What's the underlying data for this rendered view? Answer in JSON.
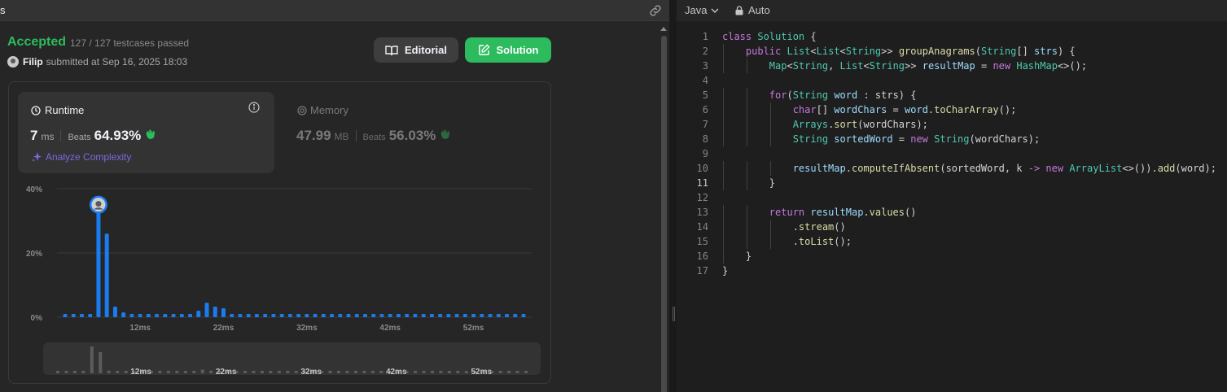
{
  "header": {
    "tab_fragment": "s",
    "link_icon": "link-icon"
  },
  "submission": {
    "status": "Accepted",
    "testcases": "127 / 127 testcases passed",
    "user": "Filip",
    "submitted_at": "submitted at Sep 16, 2025 18:03"
  },
  "buttons": {
    "editorial": "Editorial",
    "solution": "Solution"
  },
  "runtime": {
    "title": "Runtime",
    "value": "7",
    "unit": "ms",
    "beats_label": "Beats",
    "beats_pct": "64.93%",
    "analyze": "Analyze Complexity"
  },
  "memory": {
    "title": "Memory",
    "value": "47.99",
    "unit": "MB",
    "beats_label": "Beats",
    "beats_pct": "56.03%"
  },
  "chart_data": {
    "type": "bar",
    "ylabel_ticks": [
      "40%",
      "20%",
      "0%"
    ],
    "ylim": [
      0,
      40
    ],
    "x_tick_labels": [
      "12ms",
      "22ms",
      "32ms",
      "42ms",
      "52ms"
    ],
    "x_tick_values": [
      12,
      22,
      32,
      42,
      52
    ],
    "x": [
      3,
      4,
      5,
      6,
      7,
      8,
      9,
      10,
      11,
      12,
      13,
      14,
      15,
      16,
      17,
      18,
      19,
      20,
      21,
      22,
      23,
      24,
      25,
      26,
      27,
      28,
      29,
      30,
      31,
      32,
      33,
      34,
      35,
      36,
      37,
      38,
      39,
      40,
      41,
      42,
      43,
      44,
      45,
      46,
      47,
      48,
      49,
      50,
      51,
      52,
      53,
      54,
      55,
      56,
      57,
      58
    ],
    "values": [
      1,
      1,
      1,
      1,
      33,
      26,
      3.3,
      1.5,
      1,
      1,
      1,
      1,
      1,
      1,
      1,
      1,
      2,
      4.5,
      3.3,
      2.8,
      1,
      1,
      1,
      1,
      1,
      1,
      1,
      1,
      1,
      1,
      1,
      1,
      1,
      1,
      1,
      1,
      1,
      1,
      1,
      1,
      1,
      1,
      1,
      1,
      1,
      1,
      1,
      1,
      1,
      1,
      1,
      1,
      1,
      1,
      1,
      1
    ],
    "highlight_x": 7,
    "grid": true
  },
  "editor": {
    "language": "Java",
    "mode": "Auto",
    "active_line": 11,
    "lines": [
      [
        [
          "k",
          "class"
        ],
        [
          "p",
          " "
        ],
        [
          "t",
          "Solution"
        ],
        [
          "p",
          " {"
        ]
      ],
      [
        [
          "p",
          "    "
        ],
        [
          "k",
          "public"
        ],
        [
          "p",
          " "
        ],
        [
          "t",
          "List"
        ],
        [
          "p",
          "<"
        ],
        [
          "t",
          "List"
        ],
        [
          "p",
          "<"
        ],
        [
          "t",
          "String"
        ],
        [
          "p",
          ">> "
        ],
        [
          "f",
          "groupAnagrams"
        ],
        [
          "p",
          "("
        ],
        [
          "t",
          "String"
        ],
        [
          "p",
          "[] "
        ],
        [
          "v",
          "strs"
        ],
        [
          "p",
          ") {"
        ]
      ],
      [
        [
          "p",
          "        "
        ],
        [
          "t",
          "Map"
        ],
        [
          "p",
          "<"
        ],
        [
          "t",
          "String"
        ],
        [
          "p",
          ", "
        ],
        [
          "t",
          "List"
        ],
        [
          "p",
          "<"
        ],
        [
          "t",
          "String"
        ],
        [
          "p",
          ">> "
        ],
        [
          "v",
          "resultMap"
        ],
        [
          "p",
          " = "
        ],
        [
          "k",
          "new"
        ],
        [
          "p",
          " "
        ],
        [
          "t",
          "HashMap"
        ],
        [
          "p",
          "<>();"
        ]
      ],
      [],
      [
        [
          "p",
          "        "
        ],
        [
          "k",
          "for"
        ],
        [
          "p",
          "("
        ],
        [
          "t",
          "String"
        ],
        [
          "p",
          " "
        ],
        [
          "v",
          "word"
        ],
        [
          "p",
          " : strs) {"
        ]
      ],
      [
        [
          "p",
          "            "
        ],
        [
          "k",
          "char"
        ],
        [
          "p",
          "[] "
        ],
        [
          "v",
          "wordChars"
        ],
        [
          "p",
          " = "
        ],
        [
          "v",
          "word"
        ],
        [
          "p",
          "."
        ],
        [
          "f",
          "toCharArray"
        ],
        [
          "p",
          "();"
        ]
      ],
      [
        [
          "p",
          "            "
        ],
        [
          "t",
          "Arrays"
        ],
        [
          "p",
          "."
        ],
        [
          "f",
          "sort"
        ],
        [
          "p",
          "(wordChars);"
        ]
      ],
      [
        [
          "p",
          "            "
        ],
        [
          "t",
          "String"
        ],
        [
          "p",
          " "
        ],
        [
          "v",
          "sortedWord"
        ],
        [
          "p",
          " = "
        ],
        [
          "k",
          "new"
        ],
        [
          "p",
          " "
        ],
        [
          "t",
          "String"
        ],
        [
          "p",
          "(wordChars);"
        ]
      ],
      [],
      [
        [
          "p",
          "            "
        ],
        [
          "v",
          "resultMap"
        ],
        [
          "p",
          "."
        ],
        [
          "f",
          "computeIfAbsent"
        ],
        [
          "p",
          "(sortedWord, k "
        ],
        [
          "o",
          "->"
        ],
        [
          "p",
          " "
        ],
        [
          "k",
          "new"
        ],
        [
          "p",
          " "
        ],
        [
          "t",
          "ArrayList"
        ],
        [
          "p",
          "<>())."
        ],
        [
          "f",
          "add"
        ],
        [
          "p",
          "(word);"
        ]
      ],
      [
        [
          "p",
          "        }"
        ]
      ],
      [],
      [
        [
          "p",
          "        "
        ],
        [
          "k",
          "return"
        ],
        [
          "p",
          " "
        ],
        [
          "v",
          "resultMap"
        ],
        [
          "p",
          "."
        ],
        [
          "f",
          "values"
        ],
        [
          "p",
          "()"
        ]
      ],
      [
        [
          "p",
          "            ."
        ],
        [
          "f",
          "stream"
        ],
        [
          "p",
          "()"
        ]
      ],
      [
        [
          "p",
          "            ."
        ],
        [
          "f",
          "toList"
        ],
        [
          "p",
          "();"
        ]
      ],
      [
        [
          "p",
          "    }"
        ]
      ],
      [
        [
          "p",
          "}"
        ]
      ]
    ]
  }
}
